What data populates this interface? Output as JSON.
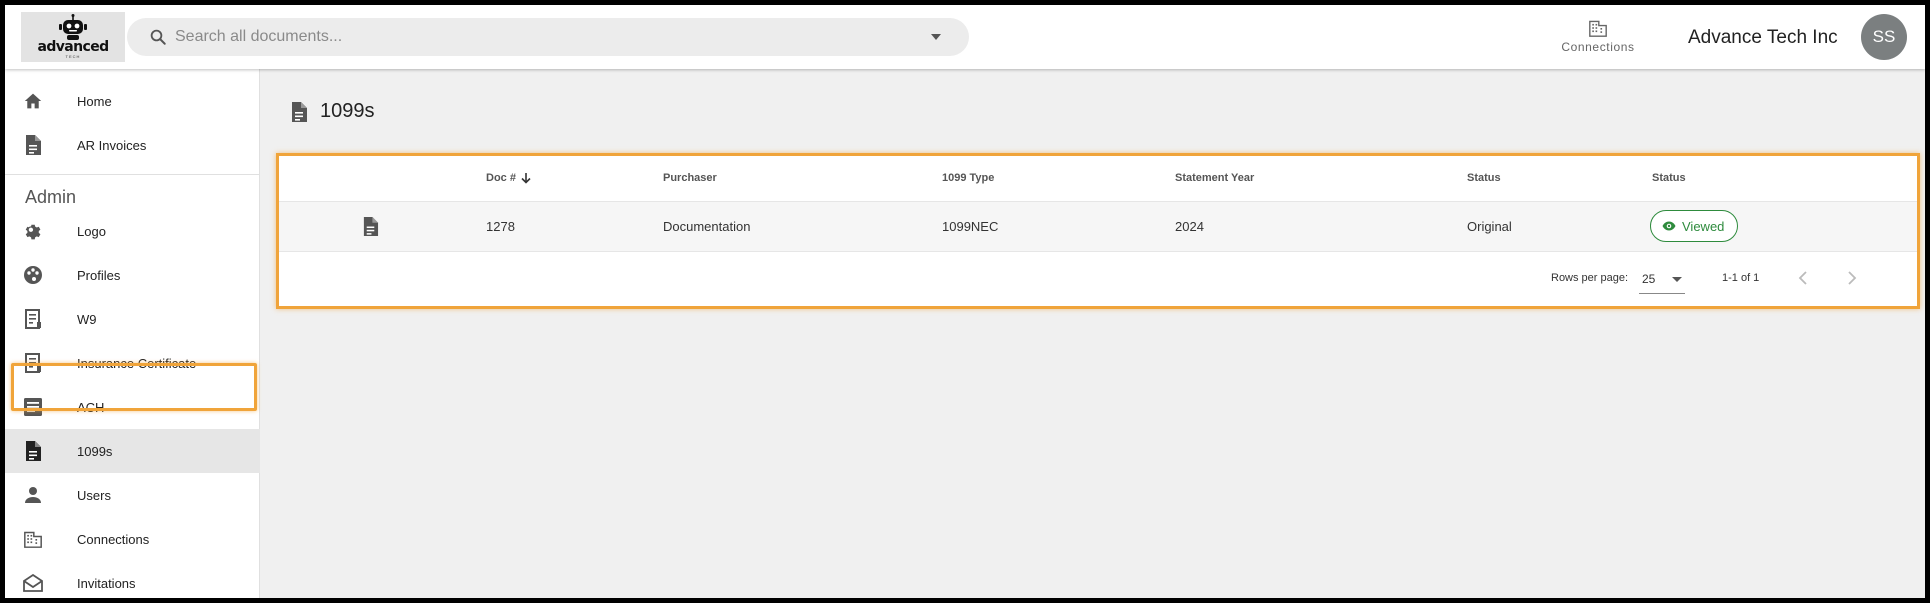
{
  "brand": {
    "logo_text": "advanced",
    "logo_sub": "TECH"
  },
  "search": {
    "placeholder": "Search all documents..."
  },
  "header": {
    "connections_label": "Connections",
    "company_name": "Advance Tech Inc",
    "avatar_initials": "SS"
  },
  "sidebar": {
    "top_items": [
      {
        "label": "Home",
        "icon": "home-icon"
      },
      {
        "label": "AR Invoices",
        "icon": "document-icon"
      }
    ],
    "admin_heading": "Admin",
    "admin_items": [
      {
        "label": "Logo",
        "icon": "gear-icon"
      },
      {
        "label": "Profiles",
        "icon": "palette-icon"
      },
      {
        "label": "W9",
        "icon": "receipt-icon"
      },
      {
        "label": "Insurance Certificate",
        "icon": "receipt-icon"
      },
      {
        "label": "ACH",
        "icon": "article-icon"
      },
      {
        "label": "1099s",
        "icon": "document-icon",
        "active": true
      },
      {
        "label": "Users",
        "icon": "person-icon"
      },
      {
        "label": "Connections",
        "icon": "building-icon"
      },
      {
        "label": "Invitations",
        "icon": "mail-open-icon"
      }
    ]
  },
  "page": {
    "title": "1099s"
  },
  "table": {
    "columns": [
      "",
      "Doc #",
      "Purchaser",
      "1099 Type",
      "Statement Year",
      "Status",
      "Status"
    ],
    "rows": [
      {
        "doc_no": "1278",
        "purchaser": "Documentation",
        "type": "1099NEC",
        "year": "2024",
        "status": "Original",
        "view_status": "Viewed"
      }
    ],
    "pagination": {
      "rows_per_page_label": "Rows per page:",
      "rows_per_page": "25",
      "range": "1-1 of 1"
    }
  },
  "colors": {
    "accent_highlight": "#f0a43a",
    "viewed_green": "#2e8b3d",
    "avatar_bg": "#7b7f80"
  }
}
